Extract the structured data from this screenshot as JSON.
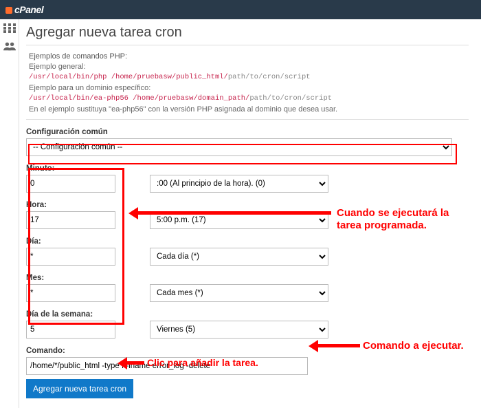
{
  "brand": "cPanel",
  "page_title": "Agregar nueva tarea cron",
  "examples": {
    "heading": "Ejemplos de comandos PHP:",
    "general_label": "Ejemplo general:",
    "general_code_red": "/usr/local/bin/php /home/pruebasw/public_html/",
    "general_code_gray": "path/to/cron/script",
    "domain_label": "Ejemplo para un dominio específico:",
    "domain_code_red": "/usr/local/bin/ea-php56 /home/pruebasw/domain_path/",
    "domain_code_gray": "path/to/cron/script",
    "hint": "En el ejemplo sustituya \"ea-php56\" con la versión PHP asignada al dominio que desea usar."
  },
  "common": {
    "label": "Configuración común",
    "selected": "-- Configuración común --"
  },
  "fields": {
    "minute": {
      "label": "Minuto:",
      "value": "0",
      "preset": ":00 (Al principio de la hora). (0)"
    },
    "hour": {
      "label": "Hora:",
      "value": "17",
      "preset": "5:00 p.m. (17)"
    },
    "day": {
      "label": "Día:",
      "value": "*",
      "preset": "Cada día (*)"
    },
    "month": {
      "label": "Mes:",
      "value": "*",
      "preset": "Cada mes (*)"
    },
    "dow": {
      "label": "Día de la semana:",
      "value": "5",
      "preset": "Viernes (5)"
    }
  },
  "command": {
    "label": "Comando:",
    "value": "/home/*/public_html -type f -iname error_log -delete"
  },
  "submit_label": "Agregar nueva tarea cron",
  "annotations": {
    "schedule_l1": "Cuando se ejecutará la",
    "schedule_l2": "tarea programada.",
    "command": "Comando a ejecutar.",
    "button": "Clic para añadir la tarea."
  }
}
